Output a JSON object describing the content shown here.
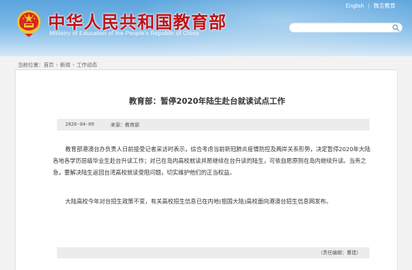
{
  "header": {
    "site_title": "中华人民共和国教育部",
    "site_subtitle": "Ministry of Education of the People's Republic of China",
    "links": [
      "English",
      "微言教育"
    ],
    "search": {
      "placeholder": ""
    },
    "colors": {
      "title": "#c0141a",
      "sky": "#5aa4dd"
    }
  },
  "breadcrumb": {
    "prefix": "当前位置：",
    "items": [
      "首页",
      "新闻",
      "工作动态"
    ]
  },
  "article": {
    "title": "教育部：暂停2020年陆生赴台就读试点工作",
    "date": "2020-04-09",
    "source": "来源：教育部",
    "paragraphs": [
      "教育部港澳台办负责人日前接受记者采访时表示，综合考虑当前新冠肺炎疫情防控及两岸关系形势，决定暂停2020年大陆各地各学历层级毕业生赴台升读工作；对已在岛内高校就读并愿继续在台升读的陆生，可依自愿原则在岛内继续升读。当务之急，要解决陆生返回台湾高校就读受阻问题，切实维护他们的正当权益。",
      "大陆高校今年对台招生政策不变，有关高校招生信息已在内地(祖国大陆)高校面向港澳台招生信息网发布。"
    ],
    "editor": "（责任编辑：曹建）"
  },
  "icons": {
    "emblem": "national-emblem-icon",
    "search": "search-icon",
    "breadcrumb_arrow": "chevron-right-icon"
  }
}
